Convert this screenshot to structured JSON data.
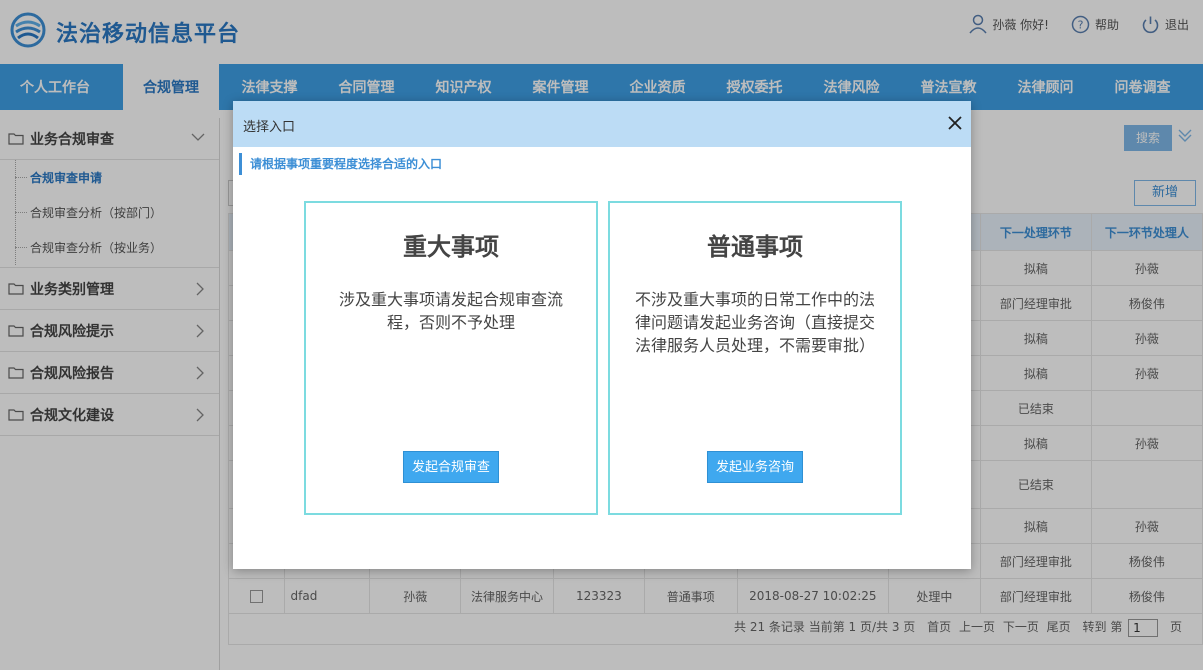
{
  "header": {
    "brand": "法治移动信息平台",
    "user_label": "孙薇 你好!",
    "help_label": "帮助",
    "logout_label": "退出"
  },
  "nav": {
    "items": [
      "个人工作台",
      "合规管理",
      "法律支撑",
      "合同管理",
      "知识产权",
      "案件管理",
      "企业资质",
      "授权委托",
      "法律风险",
      "普法宣教",
      "法律顾问",
      "问卷调查"
    ],
    "active_index": 1
  },
  "sidebar": {
    "group1": "业务合规审查",
    "sub": [
      "合规审查申请",
      "合规审查分析（按部门）",
      "合规审查分析（按业务）"
    ],
    "group2": "业务类别管理",
    "group3": "合规风险提示",
    "group4": "合规风险报告",
    "group5": "合规文化建设"
  },
  "main": {
    "search_label": "搜索",
    "add_label": "新增",
    "columns": {
      "next_step": "下一处理环节",
      "next_handler": "下一环节处理人"
    },
    "rows": [
      {
        "next_step": "拟稿",
        "next_handler": "孙薇"
      },
      {
        "next_step": "部门经理审批",
        "next_handler": "杨俊伟"
      },
      {
        "next_step": "拟稿",
        "next_handler": "孙薇"
      },
      {
        "next_step": "拟稿",
        "next_handler": "孙薇"
      },
      {
        "next_step": "已结束",
        "next_handler": ""
      },
      {
        "next_step": "拟稿",
        "next_handler": "孙薇"
      },
      {
        "next_step": "已结束",
        "next_handler": ""
      },
      {
        "next_step": "拟稿",
        "next_handler": "孙薇"
      },
      {
        "next_step": "部门经理审批",
        "next_handler": "杨俊伟"
      }
    ],
    "last_row": {
      "title": "dfad",
      "applicant": "孙薇",
      "dept": "法律服务中心",
      "code": "123323",
      "type": "普通事项",
      "time": "2018-08-27 10:02:25",
      "status": "处理中",
      "next_step": "部门经理审批",
      "next_handler": "杨俊伟"
    },
    "pager": {
      "summary": "共 21 条记录 当前第 1 页/共 3 页",
      "first": "首页",
      "prev": "上一页",
      "next": "下一页",
      "last": "尾页",
      "goto_prefix": "转到 第",
      "goto_value": "1",
      "goto_suffix": "页"
    }
  },
  "modal": {
    "title": "选择入口",
    "notice": "请根据事项重要程度选择合适的入口",
    "major": {
      "title": "重大事项",
      "desc": "涉及重大事项请发起合规审查流程，否则不予处理",
      "button": "发起合规审查"
    },
    "normal": {
      "title": "普通事项",
      "desc": "不涉及重大事项的日常工作中的法律问题请发起业务咨询（直接提交法律服务人员处理，不需要审批）",
      "button": "发起业务咨询"
    }
  }
}
